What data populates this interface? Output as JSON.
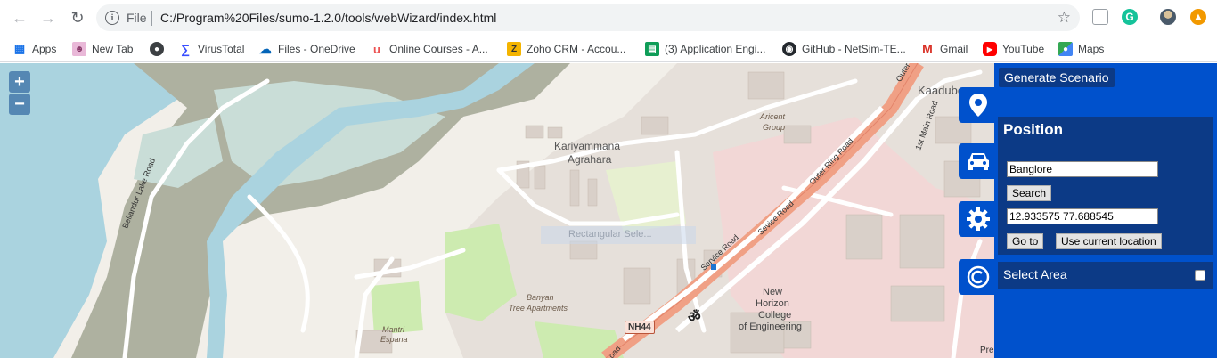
{
  "browser": {
    "url_scheme": "File",
    "url": "C:/Program%20Files/sumo-1.2.0/tools/webWizard/index.html",
    "bookmarks": [
      {
        "label": "Apps",
        "icon": "apps-grid-icon"
      },
      {
        "label": "New Tab",
        "icon": "newtab-icon"
      },
      {
        "label": "",
        "icon": "globe-icon"
      },
      {
        "label": "VirusTotal",
        "icon": "virustotal-icon"
      },
      {
        "label": "Files - OneDrive",
        "icon": "onedrive-icon"
      },
      {
        "label": "Online Courses - A...",
        "icon": "udemy-icon"
      },
      {
        "label": "Zoho CRM - Accou...",
        "icon": "zoho-icon"
      },
      {
        "label": "(3) Application Engi...",
        "icon": "sheets-icon"
      },
      {
        "label": "GitHub - NetSim-TE...",
        "icon": "github-icon"
      },
      {
        "label": "Gmail",
        "icon": "gmail-icon"
      },
      {
        "label": "YouTube",
        "icon": "youtube-icon"
      },
      {
        "label": "Maps",
        "icon": "maps-icon"
      }
    ]
  },
  "map": {
    "zoom_in": "+",
    "zoom_out": "−",
    "labels": {
      "kariyammana": "Kariyammana",
      "agrahara": "Agrahara",
      "kaadubees": "Kaadubees",
      "aricent": "Aricent",
      "group": "Group",
      "banyan": "Banyan",
      "tree_apartments": "Tree Apartments",
      "mantri": "Mantri",
      "espana": "Espana",
      "new": "New",
      "horizon": "Horizon",
      "college": "College",
      "of_engineering": "of Engineering",
      "bellandur_lake_road": "Bellandur Lake Road",
      "outer_ring_road": "Outer Ring Road",
      "service_road_1": "Service Road",
      "service_road_2": "Sevice Road",
      "first_main_road": "1st Main Road",
      "outer": "Outer",
      "nh44": "NH44",
      "om_symbol": "ॐ",
      "road_fragment": "oad",
      "pre_fragment": "Pre",
      "rectangular_select": "Rectangular Sele..."
    }
  },
  "panel": {
    "generate_label": "Generate Scenario",
    "position_title": "Position",
    "location_value": "Banglore",
    "search_label": "Search",
    "coords_value": "12.933575 77.688545",
    "goto_label": "Go to",
    "use_location_label": "Use current location",
    "select_area_label": "Select Area",
    "select_area_checked": false,
    "tabs": [
      "map-marker-icon",
      "car-icon",
      "gear-icon",
      "copyright-icon"
    ]
  },
  "colors": {
    "panel_bg": "#0051cc",
    "panel_section": "#0c3a86",
    "water": "#aad3df",
    "major_road": "#f0a085"
  }
}
